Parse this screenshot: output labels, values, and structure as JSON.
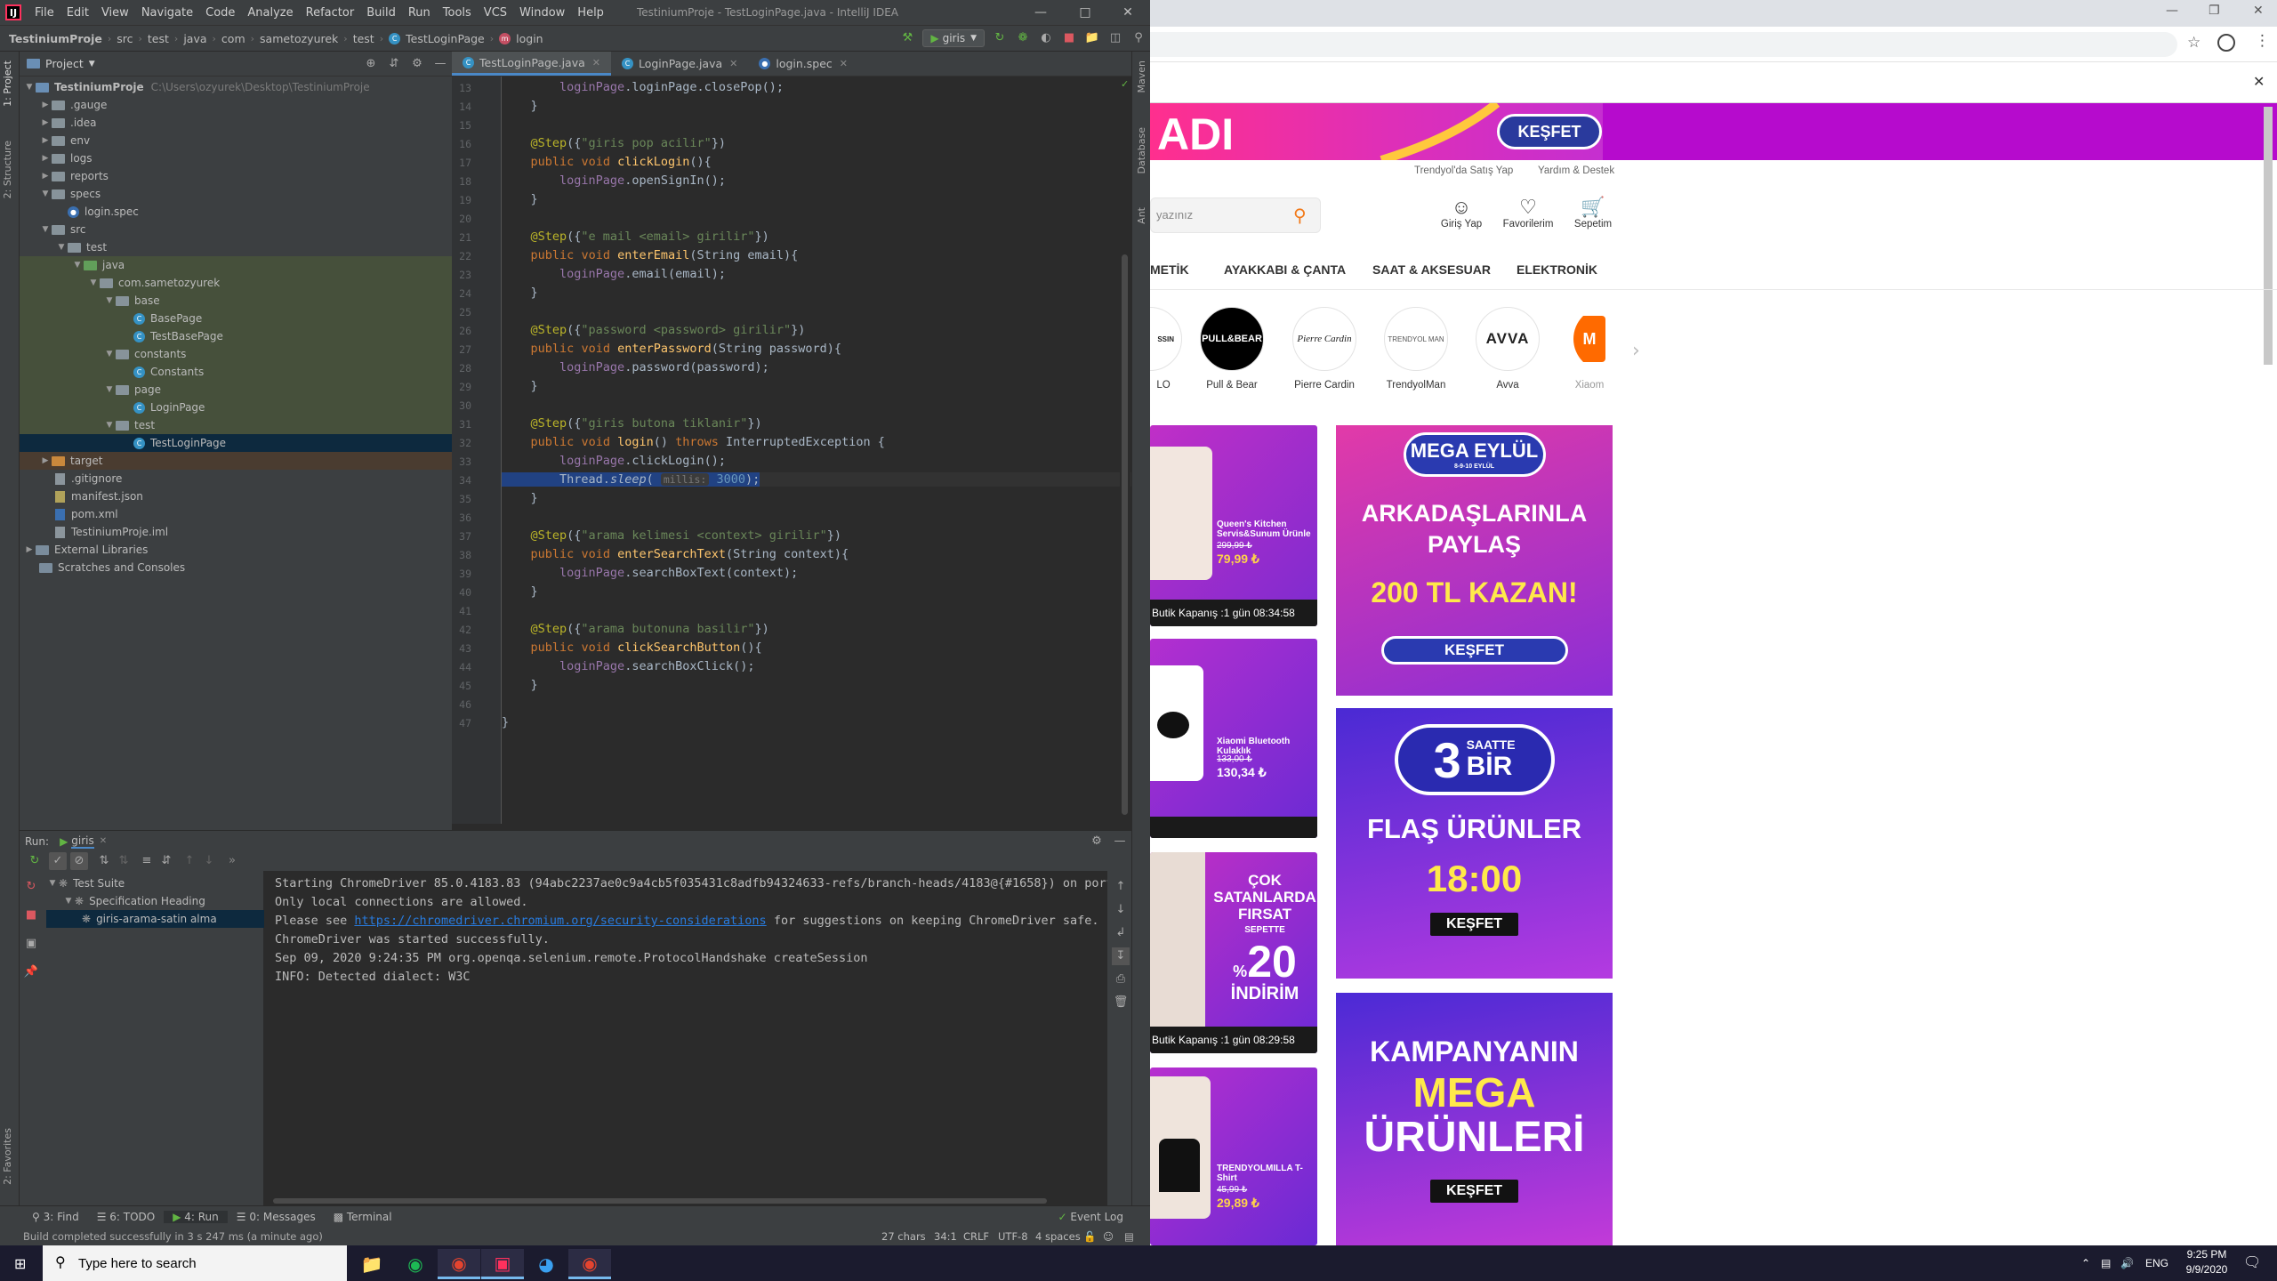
{
  "ide": {
    "menu": [
      "File",
      "Edit",
      "View",
      "Navigate",
      "Code",
      "Analyze",
      "Refactor",
      "Build",
      "Run",
      "Tools",
      "VCS",
      "Window",
      "Help"
    ],
    "window_title": "TestiniumProje - TestLoginPage.java - IntelliJ IDEA",
    "breadcrumbs": [
      "TestiniumProje",
      "src",
      "test",
      "java",
      "com",
      "sametozyurek",
      "test",
      "TestLoginPage",
      "login"
    ],
    "run_config": "giris",
    "project_header": "Project",
    "left_strip": [
      "1: Project",
      "2: Structure",
      "2: Favorites"
    ],
    "right_strip": [
      "Maven",
      "Database",
      "Ant"
    ],
    "tree": [
      {
        "label": "TestiniumProje",
        "extra": "C:\\Users\\ozyurek\\Desktop\\TestiniumProje"
      },
      {
        "label": ".gauge"
      },
      {
        "label": ".idea"
      },
      {
        "label": "env"
      },
      {
        "label": "logs"
      },
      {
        "label": "reports"
      },
      {
        "label": "specs"
      },
      {
        "label": "login.spec"
      },
      {
        "label": "src"
      },
      {
        "label": "test"
      },
      {
        "label": "java"
      },
      {
        "label": "com.sametozyurek"
      },
      {
        "label": "base"
      },
      {
        "label": "BasePage"
      },
      {
        "label": "TestBasePage"
      },
      {
        "label": "constants"
      },
      {
        "label": "Constants"
      },
      {
        "label": "page"
      },
      {
        "label": "LoginPage"
      },
      {
        "label": "test"
      },
      {
        "label": "TestLoginPage"
      },
      {
        "label": "target"
      },
      {
        "label": ".gitignore"
      },
      {
        "label": "manifest.json"
      },
      {
        "label": "pom.xml"
      },
      {
        "label": "TestiniumProje.iml"
      },
      {
        "label": "External Libraries"
      },
      {
        "label": "Scratches and Consoles"
      }
    ],
    "tabs": [
      "TestLoginPage.java",
      "LoginPage.java",
      "login.spec"
    ],
    "line_numbers": [
      "13",
      "14",
      "15",
      "16",
      "17",
      "18",
      "19",
      "20",
      "21",
      "22",
      "23",
      "24",
      "25",
      "26",
      "27",
      "28",
      "29",
      "30",
      "31",
      "32",
      "33",
      "34",
      "35",
      "36",
      "37",
      "38",
      "39",
      "40",
      "41",
      "42",
      "43",
      "44",
      "45",
      "46",
      "47"
    ],
    "code": {
      "l13": "loginPage.closePop();",
      "l14": "}",
      "l16_str": "\"giris pop acilir\"",
      "l17_mth": "clickLogin",
      "l18": "openSignIn",
      "l19": "}",
      "l21_str": "\"e mail <email> girilir\"",
      "l22_mth": "enterEmail",
      "l22_rest": "(String email){",
      "l23": "email(email);",
      "l24": "}",
      "l26_str": "\"password <password> girilir\"",
      "l27_mth": "enterPassword",
      "l27_rest": "(String password){",
      "l28": "password(password);",
      "l29": "}",
      "l31_str": "\"giris butona tiklanir\"",
      "l32_mth": "login",
      "l32_kw2": "throws",
      "l32_rest": "InterruptedException {",
      "l33": "clickLogin();",
      "l34_a": "Thread.",
      "l34_m": "sleep",
      "l34_hint": "millis:",
      "l34_num": "3000",
      "l34_end": ");",
      "l35": "}",
      "l37_str": "\"arama kelimesi <context> girilir\"",
      "l38_mth": "enterSearchText",
      "l38_rest": "(String context){",
      "l39": "searchBoxText(context);",
      "l40": "}",
      "l42_str": "\"arama butonuna basilir\"",
      "l43_mth": "clickSearchButton",
      "l44": "searchBoxClick();",
      "l45": "}",
      "l47": "}",
      "ann": "@Step",
      "pub": "public",
      "void": "void",
      "fld": "loginPage",
      "paren_open": "({",
      "paren_close": "})",
      "empty_args": "(){",
      "empty_args_sp": "() ",
      "dot": "."
    },
    "run": {
      "label": "Run:",
      "config": "giris",
      "tree": [
        "Test Suite",
        "Specification Heading",
        "giris-arama-satin alma"
      ],
      "output": [
        "Starting ChromeDriver 85.0.4183.83 (94abc2237ae0c9a4cb5f035431c8adfb94324633-refs/branch-heads/4183@{#1658}) on port",
        "Only local connections are allowed.",
        "ChromeDriver was started successfully.",
        "Sep 09, 2020 9:24:35 PM org.openqa.selenium.remote.ProtocolHandshake createSession",
        "INFO: Detected dialect: W3C"
      ],
      "please_see": "Please see ",
      "link": "https://chromedriver.chromium.org/security-considerations",
      "link_suffix": " for suggestions on keeping ChromeDriver safe."
    },
    "bottom_tabs": [
      "3: Find",
      "6: TODO",
      "4: Run",
      "0: Messages",
      "Terminal"
    ],
    "event_log": "Event Log",
    "status": {
      "message": "Build completed successfully in 3 s 247 ms (a minute ago)",
      "chars": "27 chars",
      "pos": "34:1",
      "eol": "CRLF",
      "enc": "UTF-8",
      "indent": "4 spaces"
    }
  },
  "browser": {
    "banner_title": "ADI",
    "banner_btn": "KEŞFET",
    "links": [
      "Trendyol'da Satış Yap",
      "Yardım & Destek"
    ],
    "search_placeholder": "yazınız",
    "header_icons": [
      "Giriş Yap",
      "Favorilerim",
      "Sepetim"
    ],
    "categories": [
      "METİK",
      "AYAKKABI & ÇANTA",
      "SAAT & AKSESUAR",
      "ELEKTRONİK"
    ],
    "brands": [
      "LO",
      "Pull & Bear",
      "Pierre Cardin",
      "TrendyolMan",
      "Avva",
      "Xiaom"
    ],
    "brand_logos": [
      "SSIN",
      "PULL&BEAR",
      "Pierre Cardin",
      "TRENDYOL MAN",
      "AVVA",
      "M"
    ],
    "products": [
      {
        "name": "Queen's Kitchen Servis&Sunum Ürünle",
        "old": "299,99 ₺",
        "price": "79,99 ₺",
        "timer": "Butik Kapanış :1 gün 08:34:58"
      },
      {
        "name": "Xiaomi Bluetooth Kulaklık",
        "old": "133,00 ₺",
        "price": "130,34 ₺"
      },
      {
        "title": "ÇOK SATANLARDA FIRSAT",
        "sub": "SEPETTE",
        "pct": "%",
        "big": "20",
        "tail": "İNDİRİM",
        "timer": "Butik Kapanış :1 gün 08:29:58"
      },
      {
        "name": "TRENDYOLMILLA T-Shirt",
        "old": "45,99 ₺",
        "price": "29,89 ₺"
      }
    ],
    "promos": [
      {
        "logo": "MEGA EYLÜL",
        "sub": "8-9-10 EYLÜL",
        "l1": "ARKADAŞLARINLA",
        "l2": "PAYLAŞ",
        "l3": "200 TL KAZAN!",
        "btn": "KEŞFET"
      },
      {
        "logo_a": "3",
        "logo_b": "SAATTE",
        "logo_c": "BİR",
        "l1": "FLAŞ ÜRÜNLER",
        "l2": "18:00",
        "btn": "KEŞFET"
      },
      {
        "l1": "KAMPANYANIN",
        "l2": "MEGA",
        "l3": "ÜRÜNLERİ",
        "btn": "KEŞFET"
      }
    ]
  },
  "taskbar": {
    "search": "Type here to search",
    "lang": "ENG",
    "time": "9:25 PM",
    "date": "9/9/2020"
  },
  "colors": {
    "ide_bg": "#2b2b2b",
    "trendyol_orange": "#f27a1a",
    "banner_purple": "#b60bcd"
  }
}
